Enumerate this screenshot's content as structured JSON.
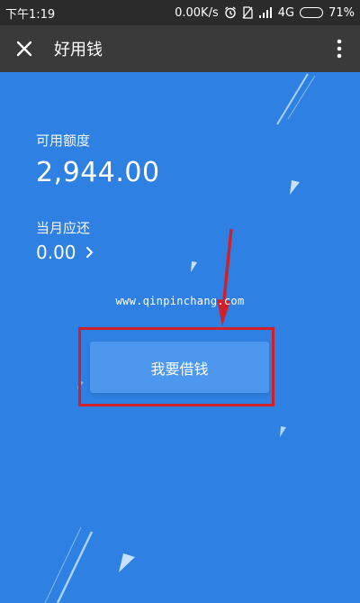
{
  "status_bar": {
    "time": "下午1:19",
    "speed": "0.00K/s",
    "network": "4G",
    "battery_percent": "71%",
    "battery_level": 0.71,
    "icons": [
      "alarm-icon",
      "no-sim-icon",
      "signal-icon",
      "battery-icon"
    ]
  },
  "title_bar": {
    "title": "好用钱",
    "close_icon": "close-icon",
    "menu_icon": "more-vert-icon"
  },
  "account": {
    "available_label": "可用额度",
    "available_amount": "2,944.00",
    "due_label": "当月应还",
    "due_amount": "0.00",
    "due_chevron": ">"
  },
  "watermark": "www.qinpinchang.com",
  "actions": {
    "borrow_label": "我要借钱"
  },
  "colors": {
    "background": "#2e80e2",
    "button": "#4d97ee",
    "title_bar": "#3a3a3a",
    "status_bar": "#2b2b2b",
    "highlight": "#d2202a"
  }
}
